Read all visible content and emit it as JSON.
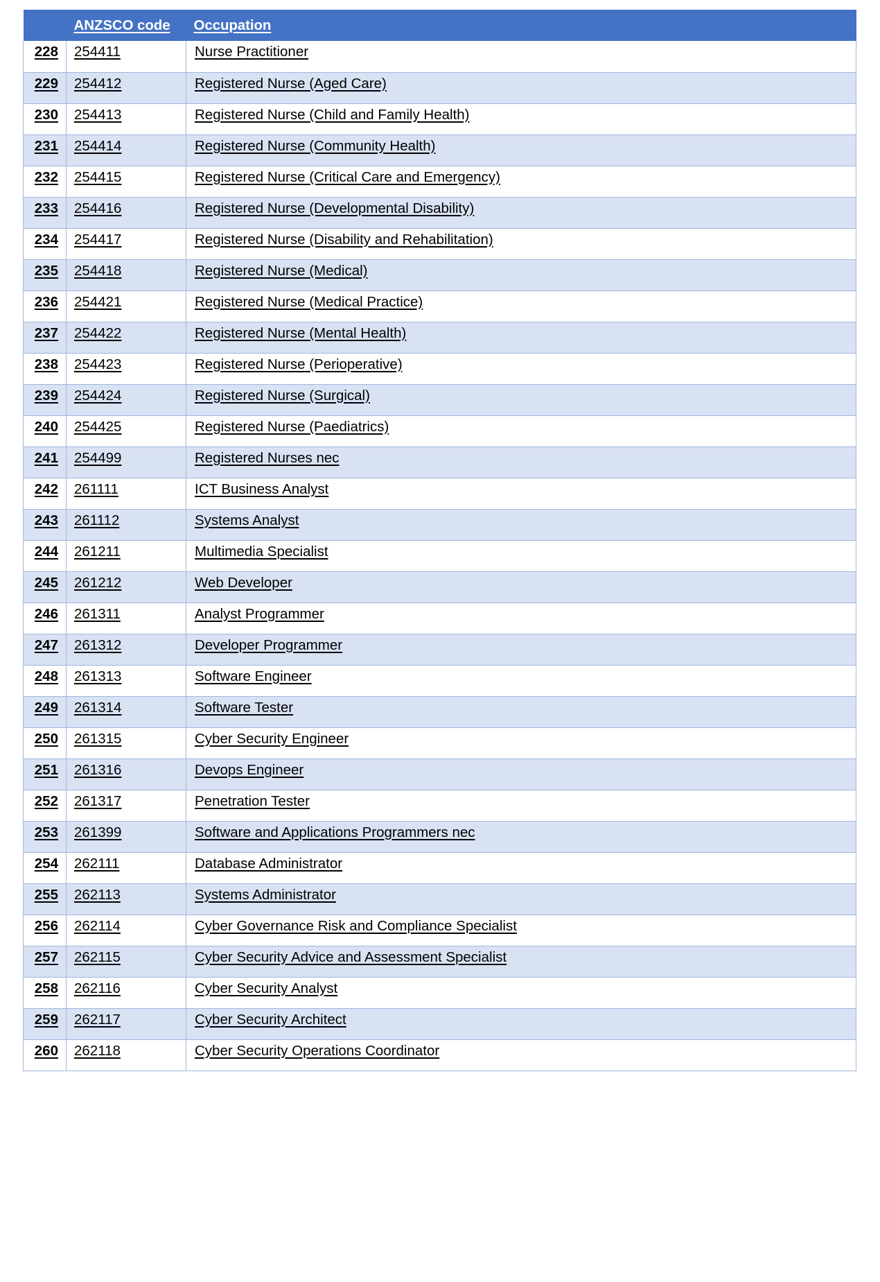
{
  "table": {
    "columns": {
      "row_number": "",
      "code": "ANZSCO code",
      "occupation": "Occupation"
    },
    "header_background": "#4472C4",
    "band_background": "#D9E2F3",
    "border_color": "#A3B6DE",
    "rows": [
      {
        "num": "228",
        "code": "254411",
        "occupation": "Nurse Practitioner"
      },
      {
        "num": "229",
        "code": "254412",
        "occupation": "Registered Nurse (Aged Care)"
      },
      {
        "num": "230",
        "code": "254413",
        "occupation": "Registered Nurse (Child and Family Health)"
      },
      {
        "num": "231",
        "code": "254414",
        "occupation": "Registered Nurse (Community Health)"
      },
      {
        "num": "232",
        "code": "254415",
        "occupation": "Registered Nurse (Critical Care and Emergency)"
      },
      {
        "num": "233",
        "code": "254416",
        "occupation": "Registered Nurse (Developmental Disability)"
      },
      {
        "num": "234",
        "code": "254417",
        "occupation": "Registered Nurse (Disability and Rehabilitation)"
      },
      {
        "num": "235",
        "code": "254418",
        "occupation": "Registered Nurse (Medical)"
      },
      {
        "num": "236",
        "code": "254421",
        "occupation": "Registered Nurse (Medical Practice)"
      },
      {
        "num": "237",
        "code": "254422",
        "occupation": "Registered Nurse (Mental Health)"
      },
      {
        "num": "238",
        "code": "254423",
        "occupation": "Registered Nurse (Perioperative)"
      },
      {
        "num": "239",
        "code": "254424",
        "occupation": "Registered Nurse (Surgical)"
      },
      {
        "num": "240",
        "code": "254425",
        "occupation": "Registered Nurse (Paediatrics)"
      },
      {
        "num": "241",
        "code": "254499",
        "occupation": "Registered Nurses nec"
      },
      {
        "num": "242",
        "code": "261111",
        "occupation": "ICT Business Analyst"
      },
      {
        "num": "243",
        "code": "261112",
        "occupation": "Systems Analyst"
      },
      {
        "num": "244",
        "code": "261211",
        "occupation": "Multimedia Specialist"
      },
      {
        "num": "245",
        "code": "261212",
        "occupation": "Web Developer"
      },
      {
        "num": "246",
        "code": "261311",
        "occupation": "Analyst Programmer"
      },
      {
        "num": "247",
        "code": "261312",
        "occupation": "Developer Programmer"
      },
      {
        "num": "248",
        "code": "261313",
        "occupation": "Software Engineer"
      },
      {
        "num": "249",
        "code": "261314",
        "occupation": "Software Tester"
      },
      {
        "num": "250",
        "code": "261315",
        "occupation": "Cyber Security Engineer"
      },
      {
        "num": "251",
        "code": "261316",
        "occupation": "Devops Engineer"
      },
      {
        "num": "252",
        "code": "261317",
        "occupation": "Penetration Tester"
      },
      {
        "num": "253",
        "code": "261399",
        "occupation": "Software and Applications Programmers nec"
      },
      {
        "num": "254",
        "code": "262111",
        "occupation": "Database Administrator"
      },
      {
        "num": "255",
        "code": "262113",
        "occupation": "Systems Administrator"
      },
      {
        "num": "256",
        "code": "262114",
        "occupation": "Cyber Governance Risk and Compliance Specialist"
      },
      {
        "num": "257",
        "code": "262115",
        "occupation": "Cyber Security Advice and Assessment Specialist"
      },
      {
        "num": "258",
        "code": "262116",
        "occupation": "Cyber Security Analyst"
      },
      {
        "num": "259",
        "code": "262117",
        "occupation": "Cyber Security Architect"
      },
      {
        "num": "260",
        "code": "262118",
        "occupation": "Cyber Security Operations Coordinator"
      }
    ]
  }
}
